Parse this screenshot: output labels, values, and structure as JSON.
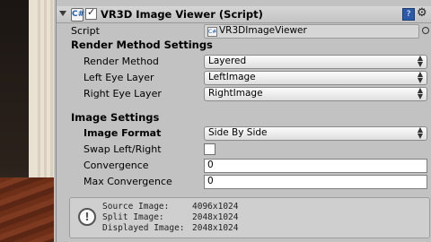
{
  "component": {
    "title": "VR3D Image Viewer (Script)",
    "enabled": true,
    "icon": "csharp-script-icon",
    "help_icon": "book-icon",
    "settings_icon": "gear-icon"
  },
  "script": {
    "label": "Script",
    "value": "VR3DImageViewer",
    "icon": "csharp-script-icon"
  },
  "render_method_settings": {
    "heading": "Render Method Settings",
    "render_method": {
      "label": "Render Method",
      "value": "Layered"
    },
    "left_eye_layer": {
      "label": "Left Eye Layer",
      "value": "LeftImage"
    },
    "right_eye_layer": {
      "label": "Right Eye Layer",
      "value": "RightImage"
    }
  },
  "image_settings": {
    "heading": "Image Settings",
    "image_format": {
      "label": "Image Format",
      "value": "Side By Side"
    },
    "swap_left_right": {
      "label": "Swap Left/Right",
      "checked": false
    },
    "convergence": {
      "label": "Convergence",
      "value": "0"
    },
    "max_convergence": {
      "label": "Max Convergence",
      "value": "0"
    }
  },
  "info": {
    "icon": "info-icon",
    "lines": [
      {
        "label": "Source Image:",
        "value": "4096x1024"
      },
      {
        "label": "Split Image:",
        "value": "2048x1024"
      },
      {
        "label": "Displayed Image:",
        "value": "2048x1024"
      }
    ]
  }
}
